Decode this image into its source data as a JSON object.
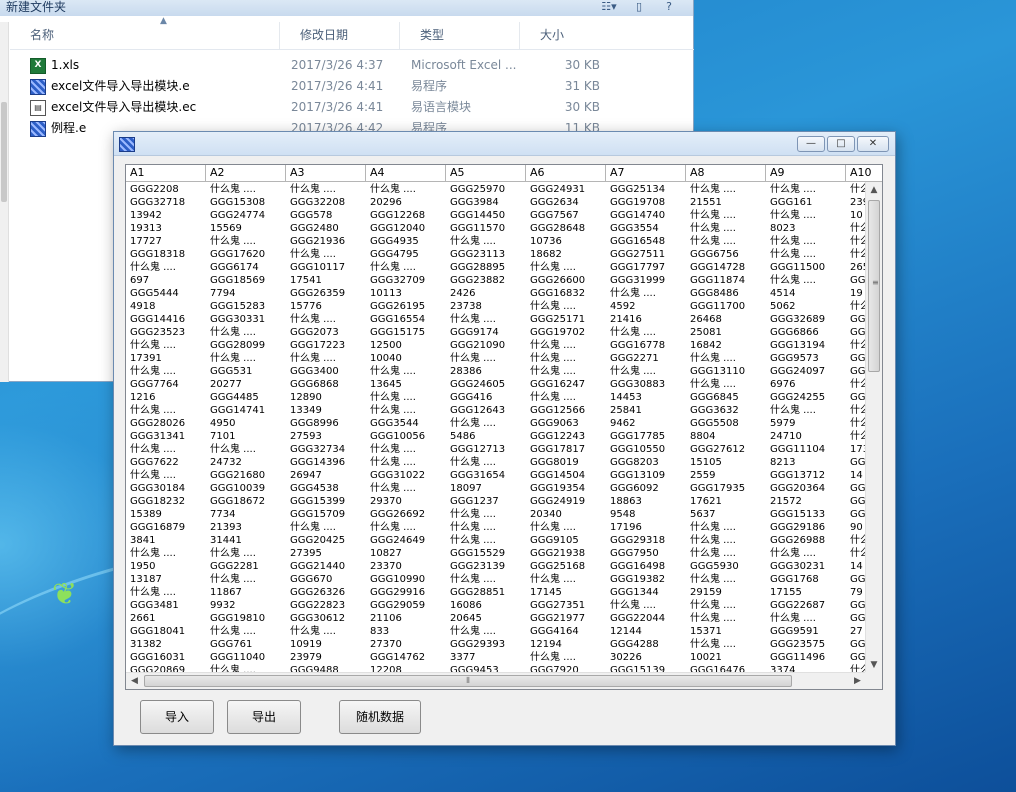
{
  "explorer": {
    "title": "新建文件夹",
    "columns": {
      "name": "名称",
      "date": "修改日期",
      "type": "类型",
      "size": "大小"
    },
    "files": [
      {
        "name": "1.xls",
        "date": "2017/3/26 4:37",
        "type": "Microsoft Excel ...",
        "size": "30 KB",
        "icon": "excel-file-icon"
      },
      {
        "name": "excel文件导入导出模块.e",
        "date": "2017/3/26 4:41",
        "type": "易程序",
        "size": "31 KB",
        "icon": "e-program-file-icon"
      },
      {
        "name": "excel文件导入导出模块.ec",
        "date": "2017/3/26 4:41",
        "type": "易语言模块",
        "size": "30 KB",
        "icon": "e-module-file-icon"
      },
      {
        "name": "例程.e",
        "date": "2017/3/26 4:42",
        "type": "易程序",
        "size": "11 KB",
        "icon": "e-program-file-icon"
      }
    ]
  },
  "app": {
    "window_buttons": {
      "minimize": "—",
      "maximize": "□",
      "close": "✕"
    },
    "columns": [
      "A1",
      "A2",
      "A3",
      "A4",
      "A5",
      "A6",
      "A7",
      "A8",
      "A9",
      "A10"
    ],
    "rows": [
      [
        "GGG2208",
        "什么鬼 ....",
        "什么鬼 ....",
        "什么鬼 ....",
        "GGG25970",
        "GGG24931",
        "GGG25134",
        "什么鬼 ....",
        "什么鬼 ....",
        "什么"
      ],
      [
        "GGG32718",
        "GGG15308",
        "GGG32208",
        "20296",
        "GGG3984",
        "GGG2634",
        "GGG19708",
        "21551",
        "GGG161",
        "239"
      ],
      [
        "13942",
        "GGG24774",
        "GGG578",
        "GGG12268",
        "GGG14450",
        "GGG7567",
        "GGG14740",
        "什么鬼 ....",
        "什么鬼 ....",
        "10"
      ],
      [
        "19313",
        "15569",
        "GGG2480",
        "GGG12040",
        "GGG11570",
        "GGG28648",
        "GGG3554",
        "什么鬼 ....",
        "8023",
        "什么"
      ],
      [
        "17727",
        "什么鬼 ....",
        "GGG21936",
        "GGG4935",
        "什么鬼 ....",
        "10736",
        "GGG16548",
        "什么鬼 ....",
        "什么鬼 ....",
        "什么"
      ],
      [
        "GGG18318",
        "GGG17620",
        "什么鬼 ....",
        "GGG4795",
        "GGG23113",
        "18682",
        "GGG27511",
        "GGG6756",
        "什么鬼 ....",
        "什么"
      ],
      [
        "什么鬼 ....",
        "GGG6174",
        "GGG10117",
        "什么鬼 ....",
        "GGG28895",
        "什么鬼 ....",
        "GGG17797",
        "GGG14728",
        "GGG11500",
        "265"
      ],
      [
        "697",
        "GGG18569",
        "17541",
        "GGG32709",
        "GGG23882",
        "GGG26600",
        "GGG31999",
        "GGG11874",
        "什么鬼 ....",
        "GG"
      ],
      [
        "GGG5444",
        "7794",
        "GGG26359",
        "10113",
        "2426",
        "GGG16832",
        "什么鬼 ....",
        "GGG8486",
        "4514",
        "19"
      ],
      [
        "4918",
        "GGG15283",
        "15776",
        "GGG26195",
        "23738",
        "什么鬼 ....",
        "4592",
        "GGG11700",
        "5062",
        "什么"
      ],
      [
        "GGG14416",
        "GGG30331",
        "什么鬼 ....",
        "GGG16554",
        "什么鬼 ....",
        "GGG25171",
        "21416",
        "26468",
        "GGG32689",
        "GG"
      ],
      [
        "GGG23523",
        "什么鬼 ....",
        "GGG2073",
        "GGG15175",
        "GGG9174",
        "GGG19702",
        "什么鬼 ....",
        "25081",
        "GGG6866",
        "GG"
      ],
      [
        "什么鬼 ....",
        "GGG28099",
        "GGG17223",
        "12500",
        "GGG21090",
        "什么鬼 ....",
        "GGG16778",
        "16842",
        "GGG13194",
        "什么"
      ],
      [
        "17391",
        "什么鬼 ....",
        "什么鬼 ....",
        "10040",
        "什么鬼 ....",
        "什么鬼 ....",
        "GGG2271",
        "什么鬼 ....",
        "GGG9573",
        "GG"
      ],
      [
        "什么鬼 ....",
        "GGG531",
        "GGG3400",
        "什么鬼 ....",
        "28386",
        "什么鬼 ....",
        "什么鬼 ....",
        "GGG13110",
        "GGG24097",
        "GG"
      ],
      [
        "GGG7764",
        "20277",
        "GGG6868",
        "13645",
        "GGG24605",
        "GGG16247",
        "GGG30883",
        "什么鬼 ....",
        "6976",
        "什么"
      ],
      [
        "1216",
        "GGG4485",
        "12890",
        "什么鬼 ....",
        "GGG416",
        "什么鬼 ....",
        "14453",
        "GGG6845",
        "GGG24255",
        "GG"
      ],
      [
        "什么鬼 ....",
        "GGG14741",
        "13349",
        "什么鬼 ....",
        "GGG12643",
        "GGG12566",
        "25841",
        "GGG3632",
        "什么鬼 ....",
        "什么"
      ],
      [
        "GGG28026",
        "4950",
        "GGG8996",
        "GGG3544",
        "什么鬼 ....",
        "GGG9063",
        "9462",
        "GGG5508",
        "5979",
        "什么"
      ],
      [
        "GGG31341",
        "7101",
        "27593",
        "GGG10056",
        "5486",
        "GGG12243",
        "GGG17785",
        "8804",
        "24710",
        "什么"
      ],
      [
        "什么鬼 ....",
        "什么鬼 ....",
        "GGG32734",
        "什么鬼 ....",
        "GGG12713",
        "GGG17817",
        "GGG10550",
        "GGG27612",
        "GGG11104",
        "173"
      ],
      [
        "GGG7622",
        "24732",
        "GGG14396",
        "什么鬼 ....",
        "什么鬼 ....",
        "GGG8019",
        "GGG8203",
        "15105",
        "8213",
        "GG"
      ],
      [
        "什么鬼 ....",
        "GGG21680",
        "26947",
        "GGG31022",
        "GGG31654",
        "GGG14504",
        "GGG13109",
        "2559",
        "GGG13712",
        "14"
      ],
      [
        "GGG30184",
        "GGG10039",
        "GGG4538",
        "什么鬼 ....",
        "18097",
        "GGG19354",
        "GGG6092",
        "GGG17935",
        "GGG20364",
        "GG"
      ],
      [
        "GGG18232",
        "GGG18672",
        "GGG15399",
        "29370",
        "GGG1237",
        "GGG24919",
        "18863",
        "17621",
        "21572",
        "GG"
      ],
      [
        "15389",
        "7734",
        "GGG15709",
        "GGG26692",
        "什么鬼 ....",
        "20340",
        "9548",
        "5637",
        "GGG15133",
        "GG"
      ],
      [
        "GGG16879",
        "21393",
        "什么鬼 ....",
        "什么鬼 ....",
        "什么鬼 ....",
        "什么鬼 ....",
        "17196",
        "什么鬼 ....",
        "GGG29186",
        "90"
      ],
      [
        "3841",
        "31441",
        "GGG20425",
        "GGG24649",
        "什么鬼 ....",
        "GGG9105",
        "GGG29318",
        "什么鬼 ....",
        "GGG26988",
        "什么"
      ],
      [
        "什么鬼 ....",
        "什么鬼 ....",
        "27395",
        "10827",
        "GGG15529",
        "GGG21938",
        "GGG7950",
        "什么鬼 ....",
        "什么鬼 ....",
        "什么"
      ],
      [
        "1950",
        "GGG2281",
        "GGG21440",
        "23370",
        "GGG23139",
        "GGG25168",
        "GGG16498",
        "GGG5930",
        "GGG30231",
        "14"
      ],
      [
        "13187",
        "什么鬼 ....",
        "GGG670",
        "GGG10990",
        "什么鬼 ....",
        "什么鬼 ....",
        "GGG19382",
        "什么鬼 ....",
        "GGG1768",
        "GG"
      ],
      [
        "什么鬼 ....",
        "11867",
        "GGG26326",
        "GGG29916",
        "GGG28851",
        "17145",
        "GGG1344",
        "29159",
        "17155",
        "79"
      ],
      [
        "GGG3481",
        "9932",
        "GGG22823",
        "GGG29059",
        "16086",
        "GGG27351",
        "什么鬼 ....",
        "什么鬼 ....",
        "GGG22687",
        "GG"
      ],
      [
        "2661",
        "GGG19810",
        "GGG30612",
        "21106",
        "20645",
        "GGG21977",
        "GGG22044",
        "什么鬼 ....",
        "什么鬼 ....",
        "GG"
      ],
      [
        "GGG18041",
        "什么鬼 ....",
        "什么鬼 ....",
        "833",
        "什么鬼 ....",
        "GGG4164",
        "12144",
        "15371",
        "GGG9591",
        "27"
      ],
      [
        "31382",
        "GGG761",
        "10919",
        "27370",
        "GGG29393",
        "12194",
        "GGG4288",
        "什么鬼 ....",
        "GGG23575",
        "GG"
      ],
      [
        "GGG16031",
        "GGG11040",
        "23979",
        "GGG14762",
        "3377",
        "什么鬼 ....",
        "30226",
        "10021",
        "GGG11496",
        "GG"
      ],
      [
        "GGG20869",
        "什么鬼 ....",
        "GGG9488",
        "12208",
        "GGG9453",
        "GGG7920",
        "GGG15139",
        "GGG16476",
        "3374",
        "什么"
      ]
    ],
    "buttons": {
      "import": "导入",
      "export": "导出",
      "random": "随机数据"
    }
  }
}
